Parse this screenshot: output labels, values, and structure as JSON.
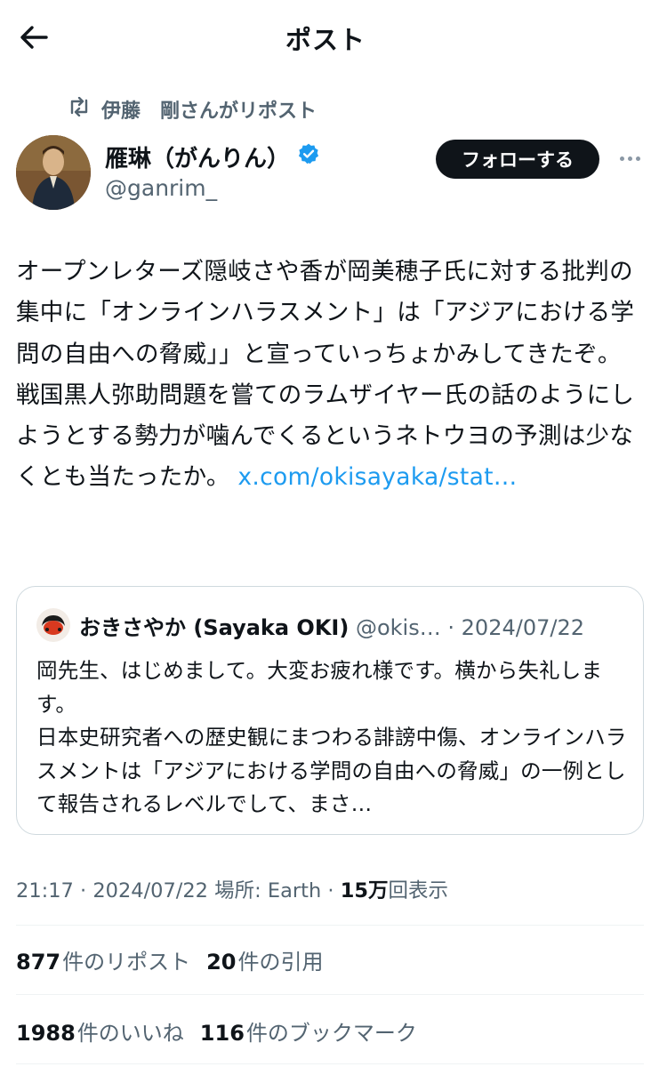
{
  "header": {
    "title": "ポスト"
  },
  "repost": {
    "text": "伊藤　剛さんがリポスト"
  },
  "author": {
    "name": "雁琳（がんりん）",
    "handle": "@ganrim_",
    "follow_label": "フォローする"
  },
  "post": {
    "text": "オープンレターズ隠岐さや香が岡美穂子氏に対する批判の集中に「オンラインハラスメント」は「アジアにおける学問の自由への脅威」」と宣っていっちょかみしてきたぞ。戦国黒人弥助問題を嘗てのラムザイヤー氏の話のようにしようとする勢力が噛んでくるというネトウヨの予測は少なくとも当たったか。 ",
    "link": "x.com/okisayaka/stat…"
  },
  "quote": {
    "name": "おきさやか (Sayaka OKI)",
    "handle": "@okis…",
    "date": "2024/07/22",
    "line1": "岡先生、はじめまして。大変お疲れ様です。横から失礼します。",
    "line2": "日本史研究者への歴史観にまつわる誹謗中傷、オンラインハラスメントは「アジアにおける学問の自由への脅威」の一例として報告されるレベルでして、まさ…"
  },
  "meta": {
    "time": "21:17",
    "date": "2024/07/22",
    "location_label": "場所: Earth",
    "views_count": "15万",
    "views_label": "回表示"
  },
  "stats": {
    "reposts_count": "877",
    "reposts_label": "件のリポスト",
    "quotes_count": "20",
    "quotes_label": "件の引用",
    "likes_count": "1988",
    "likes_label": "件のいいね",
    "bookmarks_count": "116",
    "bookmarks_label": "件のブックマーク"
  },
  "colors": {
    "link": "#1d9bf0",
    "secondary_text": "#536471",
    "verified": "#1d9bf0"
  }
}
